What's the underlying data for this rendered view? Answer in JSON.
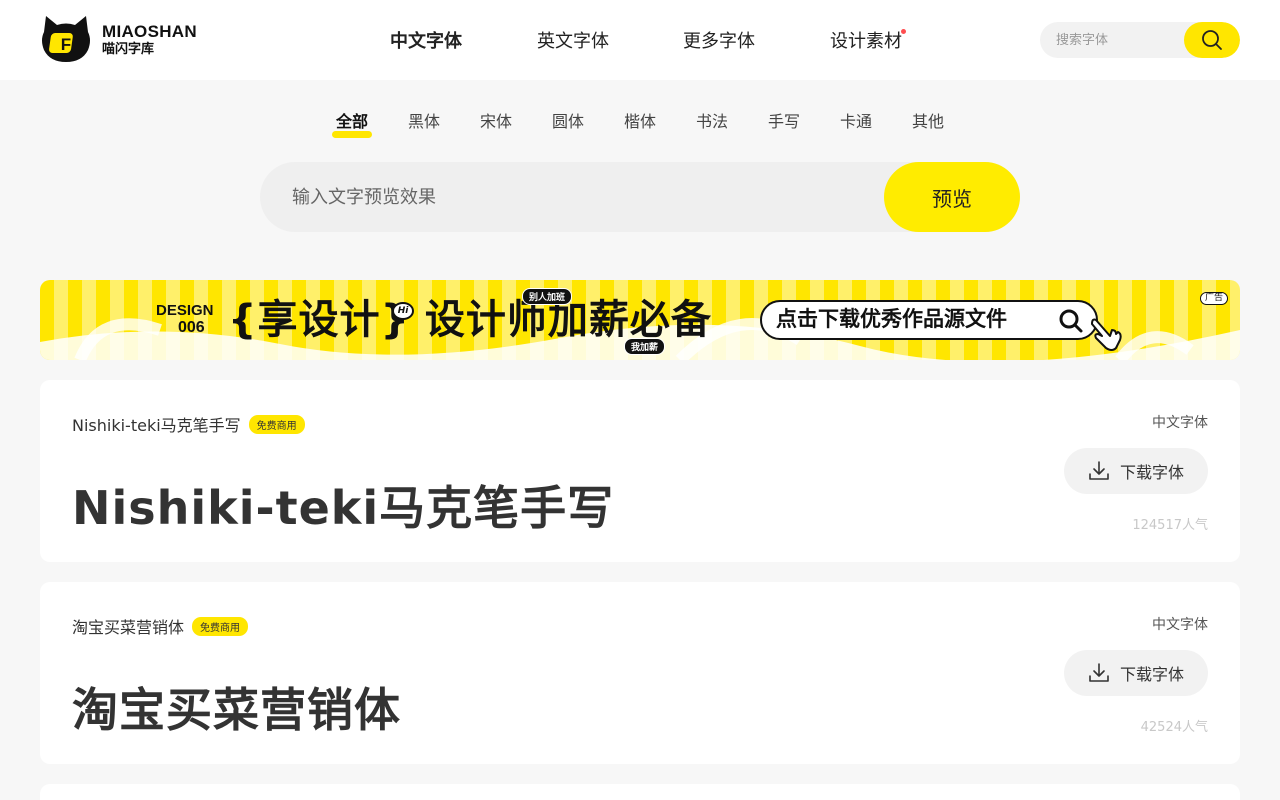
{
  "logo": {
    "en": "MIAOSHAN",
    "cn": "喵闪字库",
    "letter": "F"
  },
  "nav": {
    "items": [
      {
        "label": "中文字体",
        "active": true
      },
      {
        "label": "英文字体"
      },
      {
        "label": "更多字体"
      },
      {
        "label": "设计素材",
        "dot": true
      }
    ]
  },
  "search": {
    "placeholder": "搜索字体",
    "icon": "search-icon"
  },
  "categories": [
    "全部",
    "黑体",
    "宋体",
    "圆体",
    "楷体",
    "书法",
    "手写",
    "卡通",
    "其他"
  ],
  "preview": {
    "placeholder": "输入文字预览效果",
    "button": "预览"
  },
  "banner": {
    "design_label": "DESIGN",
    "design_num": "006",
    "headline": "{享设计} 设计师加薪必备",
    "tag_top": "别人加班",
    "tag_bottom": "我加薪",
    "hi": "Hi",
    "cta": "点击下载优秀作品源文件",
    "ad": "广告"
  },
  "fonts": [
    {
      "name": "Nishiki-teki马克笔手写",
      "badge": "免费商用",
      "sample": "Nishiki-teki马克笔手写",
      "type": "中文字体",
      "download": "下载字体",
      "popularity": "124517人气"
    },
    {
      "name": "淘宝买菜营销体",
      "badge": "免费商用",
      "sample": "淘宝买菜营销体",
      "type": "中文字体",
      "download": "下载字体",
      "popularity": "42524人气"
    }
  ],
  "colors": {
    "accent": "#ffe600",
    "dot": "#ff4d4f",
    "background": "#f7f7f7"
  }
}
